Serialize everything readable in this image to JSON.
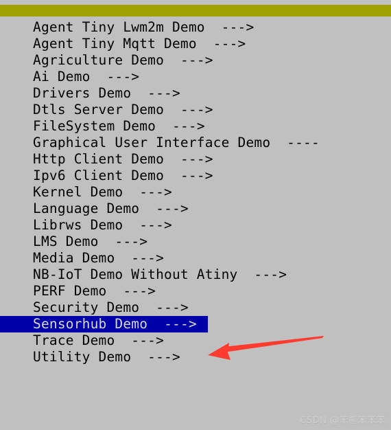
{
  "window": {
    "background_color": "#c0c0c0",
    "title_bar_color": "#a0a000",
    "clipped_top_text": "< >  < >"
  },
  "menu": {
    "selected_index": 18,
    "highlight_color": "#0000a8",
    "highlight_text_color": "#d8d8d8",
    "submenu_marker": "--->",
    "items": [
      {
        "label": "Agent Tiny Lwm2m Demo",
        "marker": "--->"
      },
      {
        "label": "Agent Tiny Mqtt Demo",
        "marker": "--->"
      },
      {
        "label": "Agriculture Demo",
        "marker": "--->"
      },
      {
        "label": "Ai Demo",
        "marker": "--->"
      },
      {
        "label": "Drivers Demo",
        "marker": "--->"
      },
      {
        "label": "Dtls Server Demo",
        "marker": "--->"
      },
      {
        "label": "FileSystem Demo",
        "marker": "--->"
      },
      {
        "label": "Graphical User Interface Demo",
        "marker": "----"
      },
      {
        "label": "Http Client Demo",
        "marker": "--->"
      },
      {
        "label": "Ipv6 Client Demo",
        "marker": "--->"
      },
      {
        "label": "Kernel Demo",
        "marker": "--->"
      },
      {
        "label": "Language Demo",
        "marker": "--->"
      },
      {
        "label": "Librws Demo",
        "marker": "--->"
      },
      {
        "label": "LMS Demo",
        "marker": "--->"
      },
      {
        "label": "Media Demo",
        "marker": "--->"
      },
      {
        "label": "NB-IoT Demo Without Atiny",
        "marker": "--->"
      },
      {
        "label": "PERF Demo",
        "marker": "--->"
      },
      {
        "label": "Security Demo",
        "marker": "--->"
      },
      {
        "label": "Sensorhub Demo",
        "marker": "--->"
      },
      {
        "label": "Trace Demo",
        "marker": "--->"
      },
      {
        "label": "Utility Demo",
        "marker": "--->"
      }
    ]
  },
  "annotation": {
    "arrow_color": "#ff3b30",
    "arrow_points_to": "Utility Demo"
  },
  "watermark": {
    "text": "CSDN @笨熊笨笨笨",
    "color": "#d0d0d0"
  }
}
